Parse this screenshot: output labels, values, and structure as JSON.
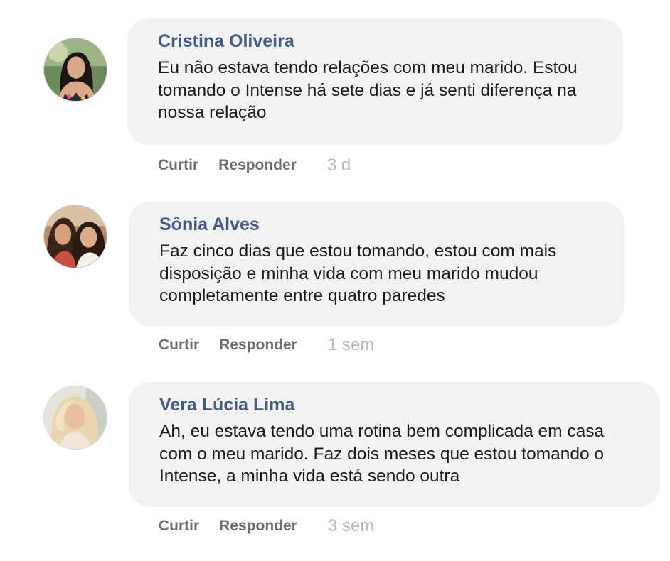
{
  "comments": [
    {
      "author": "Cristina Oliveira",
      "text": "Eu não estava tendo relações com meu marido. Estou tomando o Intense há sete dias e já senti diferença na nossa relação",
      "like_label": "Curtir",
      "reply_label": "Responder",
      "time": "3 d"
    },
    {
      "author": "Sônia Alves",
      "text": "Faz cinco dias que estou tomando, estou com mais disposição e minha vida com meu marido mudou completamente entre quatro paredes",
      "like_label": "Curtir",
      "reply_label": "Responder",
      "time": "1 sem"
    },
    {
      "author": "Vera Lúcia Lima",
      "text": "Ah, eu estava tendo uma rotina bem complicada em casa com o meu marido. Faz dois meses que estou tomando o Intense, a minha vida está sendo outra",
      "like_label": "Curtir",
      "reply_label": "Responder",
      "time": "3 sem"
    }
  ],
  "colors": {
    "author": "#475a80",
    "bubble": "#f2f2f3",
    "action": "#6e6e73",
    "time": "#b8b8bc"
  }
}
